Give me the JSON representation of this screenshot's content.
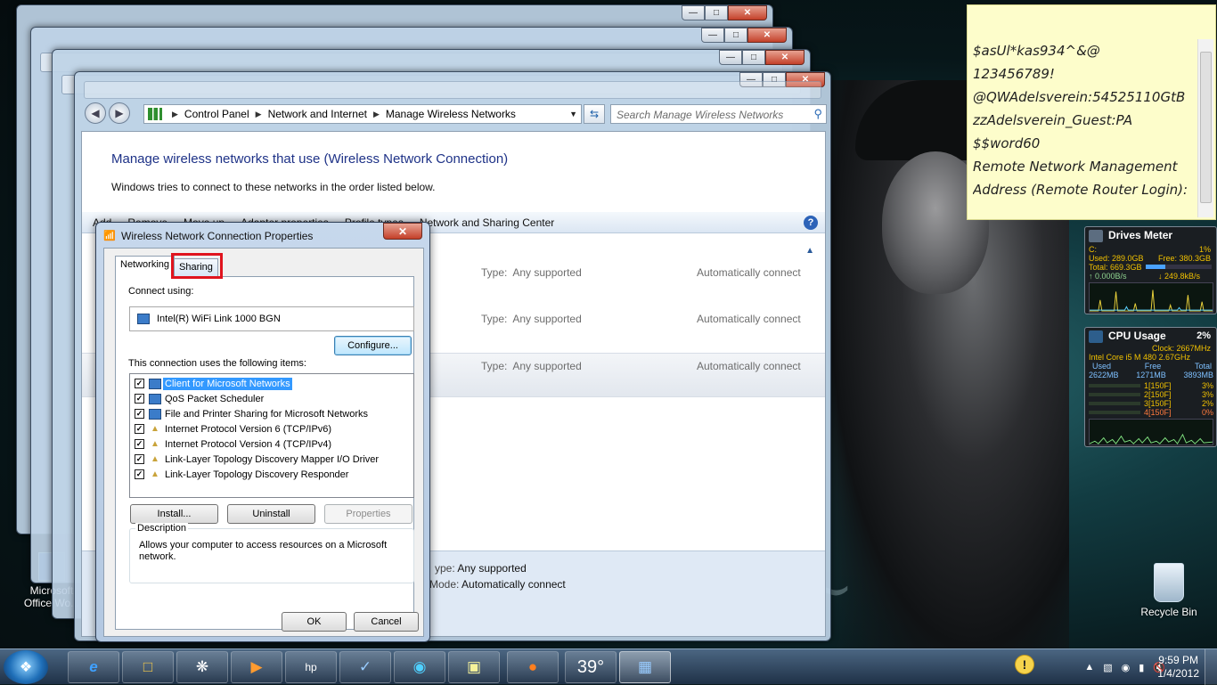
{
  "main_window": {
    "breadcrumb": [
      "Control Panel",
      "Network and Internet",
      "Manage Wireless Networks"
    ],
    "search_placeholder": "Search Manage Wireless Networks",
    "heading": "Manage wireless networks that use (Wireless Network Connection)",
    "subtext": "Windows tries to connect to these networks in the order listed below.",
    "toolbar": [
      "Add",
      "Remove",
      "Move up",
      "Adapter properties",
      "Profile types",
      "Network and Sharing Center"
    ],
    "networks": [
      {
        "type_label": "Type:",
        "type": "Any supported",
        "mode": "Automatically connect"
      },
      {
        "type_label": "Type:",
        "type": "Any supported",
        "mode": "Automatically connect"
      },
      {
        "type_label": "Type:",
        "type": "Any supported",
        "mode": "Automatically connect"
      }
    ],
    "details": {
      "type_label": "ype:",
      "type": "Any supported",
      "mode_label": "Mode:",
      "mode": "Automatically connect"
    }
  },
  "dialog": {
    "title": "Wireless Network Connection Properties",
    "tabs": [
      "Networking",
      "Sharing"
    ],
    "connect_using_label": "Connect using:",
    "adapter": "Intel(R) WiFi Link 1000 BGN",
    "configure_label": "Configure...",
    "items_label": "This connection uses the following items:",
    "items": [
      {
        "label": "Client for Microsoft Networks",
        "checked": true,
        "icon": "network-client-icon",
        "selected": true
      },
      {
        "label": "QoS Packet Scheduler",
        "checked": true,
        "icon": "network-service-icon",
        "selected": false
      },
      {
        "label": "File and Printer Sharing for Microsoft Networks",
        "checked": true,
        "icon": "network-service-icon",
        "selected": false
      },
      {
        "label": "Internet Protocol Version 6 (TCP/IPv6)",
        "checked": true,
        "icon": "protocol-icon",
        "selected": false
      },
      {
        "label": "Internet Protocol Version 4 (TCP/IPv4)",
        "checked": true,
        "icon": "protocol-icon",
        "selected": false
      },
      {
        "label": "Link-Layer Topology Discovery Mapper I/O Driver",
        "checked": true,
        "icon": "protocol-icon",
        "selected": false
      },
      {
        "label": "Link-Layer Topology Discovery Responder",
        "checked": true,
        "icon": "protocol-icon",
        "selected": false
      }
    ],
    "install_label": "Install...",
    "uninstall_label": "Uninstall",
    "properties_label": "Properties",
    "description_label": "Description",
    "description": "Allows your computer to access resources on a Microsoft network.",
    "ok_label": "OK",
    "cancel_label": "Cancel"
  },
  "sticky_note": {
    "lines": [
      "$asUl*kas934^&@",
      "123456789!",
      "@QWAdelsverein:54525110GtB",
      "zzAdelsverein_Guest:PA",
      "$$word60",
      "Remote Network Management",
      "Address (Remote Router Login):"
    ]
  },
  "drives_meter": {
    "title": "Drives Meter",
    "drive": "C:",
    "percent": "1%",
    "used": "Used: 289.0GB",
    "free": "Free: 380.3GB",
    "total": "Total: 669.3GB",
    "read": "0.000B/s",
    "write": "249.8kB/s"
  },
  "cpu_usage": {
    "title": "CPU Usage",
    "percent": "2%",
    "clock": "Clock: 2667MHz",
    "cpu": "Intel Core i5 M 480 2.67GHz",
    "mem_headers": [
      "Used",
      "Free",
      "Total"
    ],
    "mem_values": [
      "2622MB",
      "1271MB",
      "3893MB"
    ],
    "cores": [
      {
        "label": "1[150F]",
        "value": "3%"
      },
      {
        "label": "2[150F]",
        "value": "3%"
      },
      {
        "label": "3[150F]",
        "value": "2%"
      },
      {
        "label": "4[150F]",
        "value": "0%"
      }
    ]
  },
  "desktop": {
    "recycle_bin": "Recycle Bin",
    "office_icon_line1": "Microsoft",
    "office_icon_line2": "Office Wo..."
  },
  "taskbar": {
    "weather": "39°",
    "time": "9:59 PM",
    "date": "1/4/2012"
  }
}
